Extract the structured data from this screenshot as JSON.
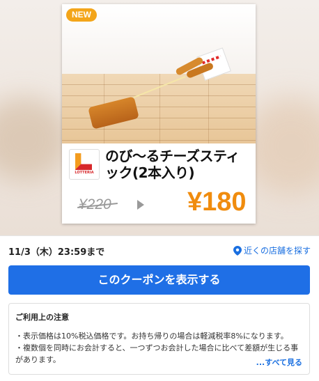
{
  "coupon": {
    "badge": "NEW",
    "brand_logo_text": "LOTTERIA",
    "title": "のび～るチーズスティック(2本入り)",
    "old_price": "¥220",
    "new_price": "¥180"
  },
  "meta": {
    "expiry": "11/3（木）23:59まで",
    "store_link": "近くの店舗を探す"
  },
  "cta": {
    "label": "このクーポンを表示する"
  },
  "notice": {
    "heading": "ご利用上の注意",
    "lines": [
      "・表示価格は10%税込価格です。お持ち帰りの場合は軽減税率8%になります。",
      "・複数個を同時にお会計すると、一つずつお会計した場合に比べて差額が生じる事があります。"
    ],
    "more": "...すべて見る"
  },
  "colors": {
    "price_accent": "#f08c0e",
    "cta_blue": "#1f6fe6",
    "badge_orange": "#f3a51a"
  }
}
